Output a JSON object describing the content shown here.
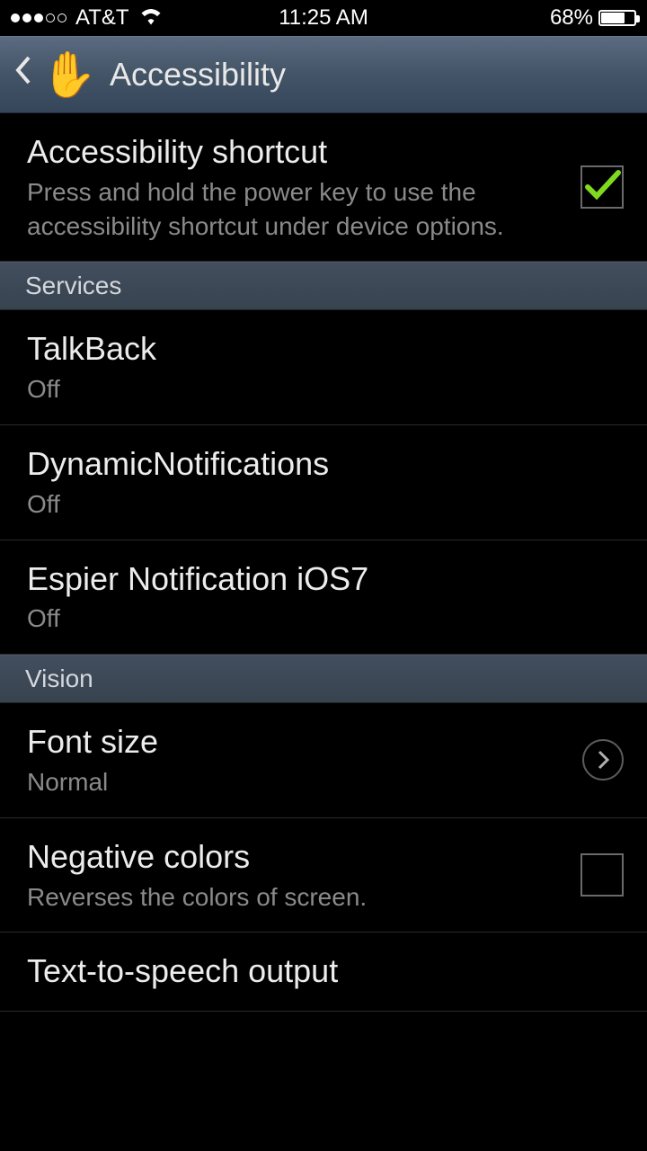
{
  "status": {
    "carrier": "AT&T",
    "time": "11:25 AM",
    "battery_pct": "68%"
  },
  "header": {
    "title": "Accessibility"
  },
  "items": {
    "shortcut": {
      "title": "Accessibility shortcut",
      "desc": "Press and hold the power key to use the accessibility shortcut under device options."
    },
    "section_services": "Services",
    "talkback": {
      "title": "TalkBack",
      "status": "Off"
    },
    "dynamic": {
      "title": "DynamicNotifications",
      "status": "Off"
    },
    "espier": {
      "title": "Espier Notification iOS7",
      "status": "Off"
    },
    "section_vision": "Vision",
    "fontsize": {
      "title": "Font size",
      "status": "Normal"
    },
    "negative": {
      "title": "Negative colors",
      "desc": "Reverses the colors of screen."
    },
    "tts": {
      "title": "Text-to-speech output"
    }
  }
}
